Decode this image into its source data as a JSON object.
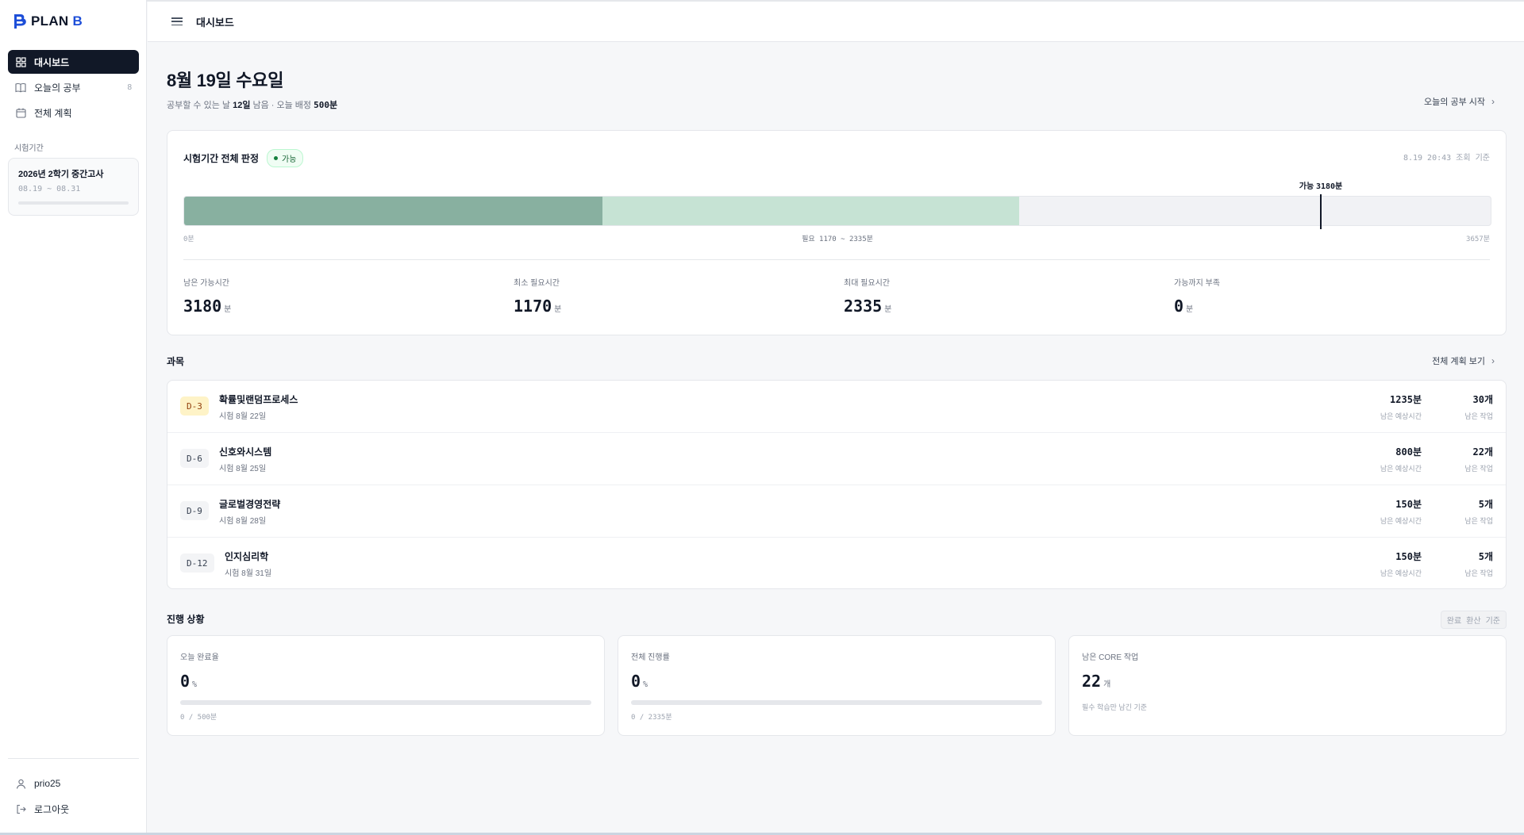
{
  "brand": {
    "name_prefix": "PLAN",
    "name_suffix": "B"
  },
  "header": {
    "title": "대시보드"
  },
  "sidebar": {
    "items": [
      {
        "label": "대시보드",
        "icon": "grid-icon",
        "active": true
      },
      {
        "label": "오늘의 공부",
        "icon": "book-icon",
        "count": "8"
      },
      {
        "label": "전체 계획",
        "icon": "calendar-icon"
      }
    ],
    "section_label": "시험기간",
    "exam": {
      "title": "2026년 2학기 중간고사",
      "range": "08.19 ~ 08.31"
    },
    "user": "prio25",
    "logout": "로그아웃"
  },
  "page": {
    "title": "8월 19일 수요일",
    "sub_prefix": "공부할 수 있는 날",
    "days_left": "12일",
    "sub_mid": "남음 · 오늘 배정",
    "today_minutes": "500분",
    "start_link": "오늘의 공부 시작"
  },
  "judgement": {
    "title": "시험기간 전체 판정",
    "status": "가능",
    "timestamp": "8.19 20:43 조회 기준",
    "marker_label": "가능",
    "marker_value": "3180분",
    "axis_min": "0분",
    "axis_center": "필요 1170 ~ 2335분",
    "axis_max": "3657분",
    "bar": {
      "min_required": 1170,
      "max_required": 2335,
      "available": 3180,
      "total": 3657
    },
    "stats": [
      {
        "label": "남은 가능시간",
        "value": "3180",
        "unit": "분"
      },
      {
        "label": "최소 필요시간",
        "value": "1170",
        "unit": "분"
      },
      {
        "label": "최대 필요시간",
        "value": "2335",
        "unit": "분"
      },
      {
        "label": "가능까지 부족",
        "value": "0",
        "unit": "분"
      }
    ]
  },
  "subjects": {
    "title": "과목",
    "link": "전체 계획 보기",
    "col_minutes_label": "남은 예상시간",
    "col_tasks_label": "남은 작업",
    "rows": [
      {
        "dday": "D-3",
        "name": "확률및랜덤프로세스",
        "date": "시험 8월 22일",
        "minutes": "1235분",
        "tasks": "30개"
      },
      {
        "dday": "D-6",
        "name": "신호와시스템",
        "date": "시험 8월 25일",
        "minutes": "800분",
        "tasks": "22개"
      },
      {
        "dday": "D-9",
        "name": "글로벌경영전략",
        "date": "시험 8월 28일",
        "minutes": "150분",
        "tasks": "5개"
      },
      {
        "dday": "D-12",
        "name": "인지심리학",
        "date": "시험 8월 31일",
        "minutes": "150분",
        "tasks": "5개"
      }
    ]
  },
  "progress": {
    "title": "진행 상황",
    "note": "완료 환산 기준",
    "cards": [
      {
        "label": "오늘 완료율",
        "value": "0",
        "unit": "%",
        "fraction": 0,
        "foot": "0 / 500분"
      },
      {
        "label": "전체 진행률",
        "value": "0",
        "unit": "%",
        "fraction": 0,
        "foot": "0 / 2335분"
      },
      {
        "label": "남은 CORE 작업",
        "value": "22",
        "unit": "개",
        "note": "필수 학습만 남긴 기준"
      }
    ]
  },
  "colors": {
    "accent": "#111827",
    "bar_min": "#88b0a0",
    "bar_range": "#c6e3d4",
    "ok": "#15803d",
    "brand_blue": "#1d4ed8"
  }
}
